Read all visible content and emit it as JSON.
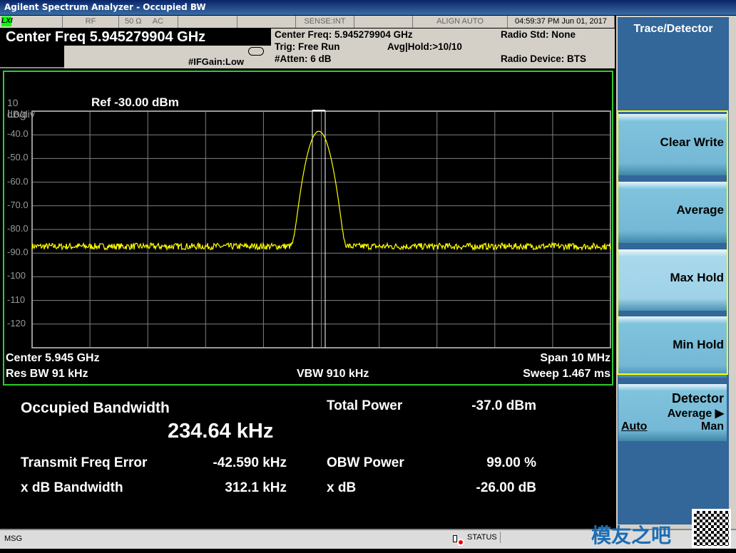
{
  "window": {
    "title": "Agilent Spectrum Analyzer - Occupied BW"
  },
  "status_row": {
    "lxi": "LXI",
    "rf": "RF",
    "impedance": "50 Ω",
    "coupling": "AC",
    "sense": "SENSE:INT",
    "align": "ALIGN AUTO",
    "datetime": "04:59:37 PM Jun 01, 2017"
  },
  "center_freq_bar": "Center Freq  5.945279904 GHz",
  "if_gain": "#IFGain:Low",
  "info": {
    "center_freq": "Center Freq: 5.945279904 GHz",
    "trig": "Trig: Free Run",
    "avg_hold": "Avg|Hold:>10/10",
    "atten": "#Atten: 6 dB",
    "radio_std": "Radio Std: None",
    "radio_device": "Radio Device: BTS"
  },
  "plot": {
    "scale": "10 dB/div",
    "ref": "Ref -30.00 dBm",
    "log": "Log",
    "y_ticks": [
      "-40.0",
      "-50.0",
      "-60.0",
      "-70.0",
      "-80.0",
      "-90.0",
      "-100",
      "-110",
      "-120"
    ],
    "center": "Center  5.945 GHz",
    "res_bw": "Res BW  91 kHz",
    "vbw": "VBW  910 kHz",
    "span": "Span 10 MHz",
    "sweep": "Sweep  1.467 ms",
    "trace_color": "#ffff00",
    "grid_color": "#808080",
    "border_color": "#2ecc2e"
  },
  "chart_data": {
    "type": "line",
    "xlabel": "",
    "ylabel": "",
    "ylim": [
      -130,
      -30
    ],
    "x_center_ghz": 5.945,
    "span_mhz": 10,
    "peak_dbm": -38.5,
    "noise_floor_dbm": -87.5,
    "grid": true
  },
  "measurements": {
    "obw_label": "Occupied Bandwidth",
    "obw_value": "234.64 kHz",
    "total_power_label": "Total Power",
    "total_power_value": "-37.0 dBm",
    "tfe_label": "Transmit Freq Error",
    "tfe_value": "-42.590 kHz",
    "obw_power_label": "OBW Power",
    "obw_power_value": "99.00 %",
    "xdb_bw_label": "x dB Bandwidth",
    "xdb_bw_value": "312.1 kHz",
    "xdb_label": "x dB",
    "xdb_value": "-26.00 dB"
  },
  "softkeys": {
    "title": "Trace/Detector",
    "clear_write": "Clear Write",
    "average": "Average",
    "max_hold": "Max Hold",
    "min_hold": "Min Hold",
    "detector": "Detector",
    "detector_value": "Average ▶",
    "auto": "Auto",
    "man": "Man"
  },
  "bottom": {
    "msg": "MSG",
    "status": "STATUS"
  },
  "watermark": "模友之吧"
}
